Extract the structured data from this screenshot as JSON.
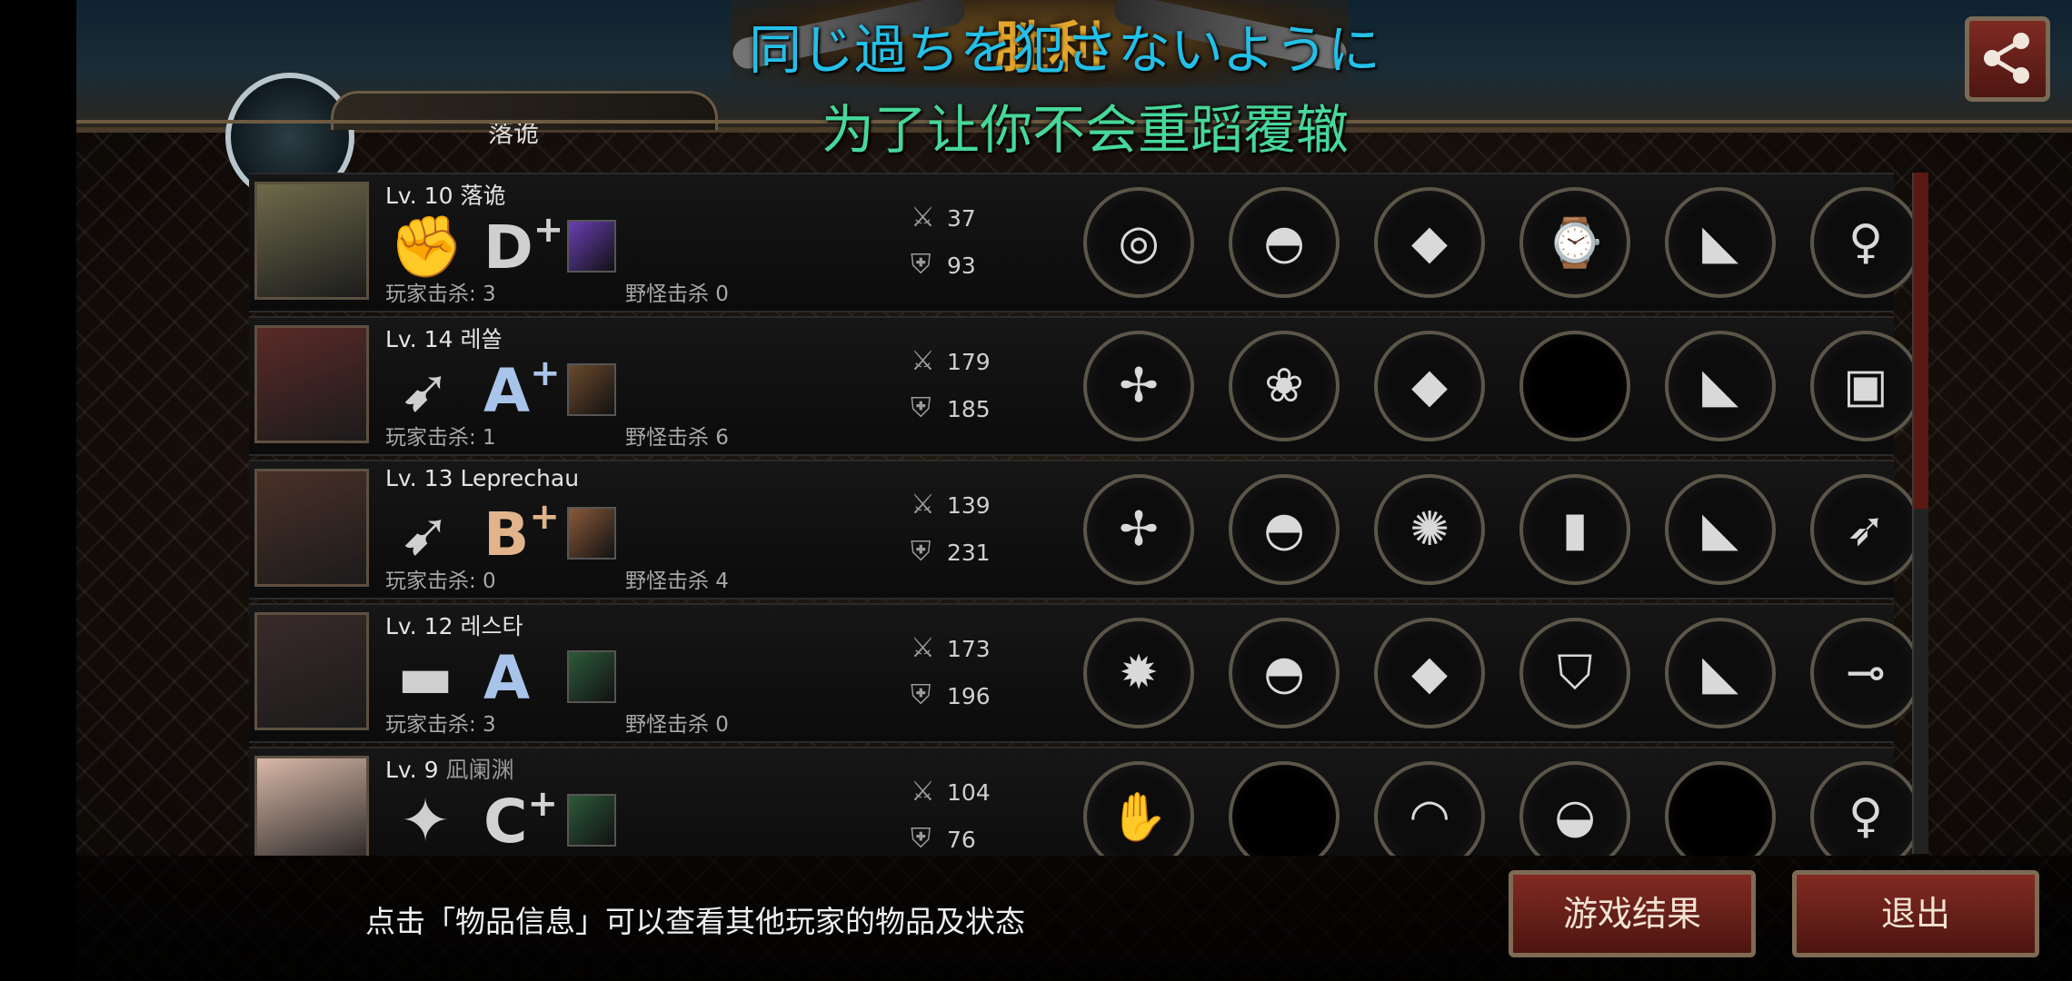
{
  "header": {
    "title_emblem": "胜利",
    "player_name": "落诡",
    "subtitle_jp": "同じ過ちを犯さないように",
    "subtitle_zh": "为了让你不会重蹈覆辙",
    "share_icon": "share-icon"
  },
  "players": [
    {
      "level": "Lv. 10",
      "name": "落诡",
      "name_style": "normal",
      "weapon_icon": "fist-icon",
      "weapon_glyph": "✊",
      "grade": "D",
      "grade_plus": "+",
      "grade_color": "#cfcfcf",
      "skill_color": "#6a3fb6",
      "player_kills": "玩家击杀: 3",
      "monster_kills": "野怪击杀 0",
      "attack": "37",
      "defense": "93",
      "portrait_color": "#6e6a4a",
      "items": [
        {
          "name": "brass-knuckles",
          "glyph": "◎",
          "empty": false
        },
        {
          "name": "bike-helmet",
          "glyph": "◓",
          "empty": false
        },
        {
          "name": "blue-armor",
          "glyph": "◆",
          "empty": false
        },
        {
          "name": "wristwatch",
          "glyph": "⌚",
          "empty": false
        },
        {
          "name": "leather-boots",
          "glyph": "◣",
          "empty": false
        },
        {
          "name": "doll",
          "glyph": "♀",
          "empty": false
        }
      ]
    },
    {
      "level": "Lv. 14",
      "name": "레쏠",
      "name_style": "normal",
      "weapon_icon": "bow-icon",
      "weapon_glyph": "➹",
      "grade": "A",
      "grade_plus": "+",
      "grade_color": "#a9c4ea",
      "skill_color": "#6b4a2e",
      "player_kills": "玩家击杀: 1",
      "monster_kills": "野怪击杀 6",
      "attack": "179",
      "defense": "185",
      "portrait_color": "#5a2a28",
      "items": [
        {
          "name": "crossbow",
          "glyph": "✢",
          "empty": false
        },
        {
          "name": "laurel-wreath",
          "glyph": "❀",
          "empty": false
        },
        {
          "name": "plate-armor",
          "glyph": "◆",
          "empty": false
        },
        {
          "name": "empty-slot",
          "glyph": "",
          "empty": true
        },
        {
          "name": "armored-boots",
          "glyph": "◣",
          "empty": false
        },
        {
          "name": "wooden-crate",
          "glyph": "▣",
          "empty": false
        }
      ]
    },
    {
      "level": "Lv. 13",
      "name": "Leprechau",
      "name_style": "normal",
      "weapon_icon": "bow-icon",
      "weapon_glyph": "➹",
      "grade": "B",
      "grade_plus": "+",
      "grade_color": "#e2b48c",
      "skill_color": "#8a5a3c",
      "player_kills": "玩家击杀: 0",
      "monster_kills": "野怪击杀 4",
      "attack": "139",
      "defense": "231",
      "portrait_color": "#4a3028",
      "items": [
        {
          "name": "crossbow",
          "glyph": "✢",
          "empty": false
        },
        {
          "name": "knight-helmet",
          "glyph": "◓",
          "empty": false
        },
        {
          "name": "flame-armor",
          "glyph": "✺",
          "empty": false
        },
        {
          "name": "bullet",
          "glyph": "▮",
          "empty": false
        },
        {
          "name": "steel-boots",
          "glyph": "◣",
          "empty": false
        },
        {
          "name": "quiver",
          "glyph": "➶",
          "empty": false
        }
      ]
    },
    {
      "level": "Lv. 12",
      "name": "레스타",
      "name_style": "normal",
      "weapon_icon": "pistol-icon",
      "weapon_glyph": "▬",
      "grade": "A",
      "grade_plus": "",
      "grade_color": "#a9c4ea",
      "skill_color": "#2e5a3a",
      "player_kills": "玩家击杀: 3",
      "monster_kills": "野怪击杀 0",
      "attack": "173",
      "defense": "196",
      "portrait_color": "#3a2a2a",
      "items": [
        {
          "name": "rocket-launcher",
          "glyph": "✹",
          "empty": false
        },
        {
          "name": "motocross-helmet",
          "glyph": "◓",
          "empty": false
        },
        {
          "name": "red-jacket",
          "glyph": "◆",
          "empty": false
        },
        {
          "name": "golden-shield",
          "glyph": "⛉",
          "empty": false
        },
        {
          "name": "combat-boots",
          "glyph": "◣",
          "empty": false
        },
        {
          "name": "rifle-scope",
          "glyph": "⊸",
          "empty": false
        }
      ]
    },
    {
      "level": "Lv. 9",
      "name": "凪阑渊",
      "name_style": "gray",
      "weapon_icon": "shuriken-icon",
      "weapon_glyph": "✦",
      "grade": "C",
      "grade_plus": "+",
      "grade_color": "#d2d2d2",
      "skill_color": "#2e5a3a",
      "player_kills": "",
      "monster_kills": "",
      "attack": "104",
      "defense": "76",
      "portrait_color": "#d8b8a8",
      "items": [
        {
          "name": "gauntlet",
          "glyph": "✋",
          "empty": false
        },
        {
          "name": "empty-slot",
          "glyph": "",
          "empty": true
        },
        {
          "name": "red-ribbon-arm",
          "glyph": "◠",
          "empty": false
        },
        {
          "name": "arm-guard",
          "glyph": "◒",
          "empty": false
        },
        {
          "name": "empty-slot",
          "glyph": "",
          "empty": true
        },
        {
          "name": "doll",
          "glyph": "♀",
          "empty": false
        }
      ]
    }
  ],
  "footer": {
    "hint": "点击「物品信息」可以查看其他玩家的物品及状态",
    "result_button": "游戏结果",
    "exit_button": "退出"
  },
  "colors": {
    "accent_red": "#812a22",
    "subtitle_jp": "#23c0e8",
    "subtitle_zh": "#46d89a",
    "victory_gold": "#e3a62c"
  }
}
